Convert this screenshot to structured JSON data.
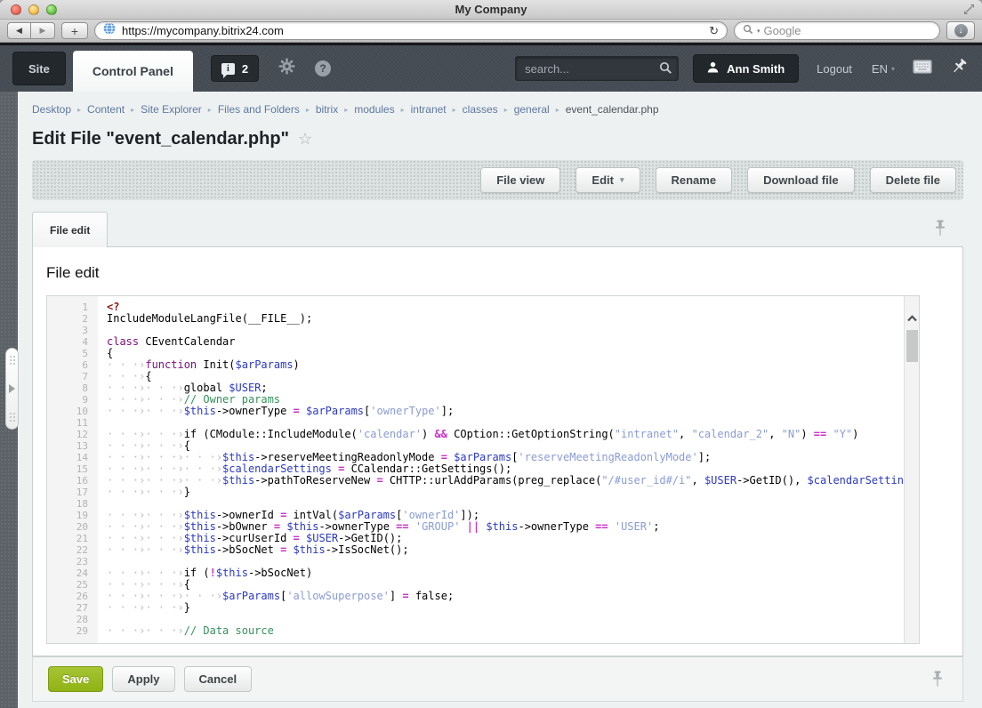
{
  "window": {
    "title": "My Company"
  },
  "browser": {
    "url": "https://mycompany.bitrix24.com",
    "web_search_placeholder": "Google"
  },
  "icons": {
    "back": "◀",
    "forward": "▶",
    "new_tab": "+",
    "reload": "↻",
    "download_arrow": "↓",
    "caret_down": "▾",
    "breadcrumb_separator": "▸",
    "info": "i",
    "help": "?",
    "star": "☆"
  },
  "header": {
    "site_tab_label": "Site",
    "control_panel_tab_label": "Control Panel",
    "notification_count": "2",
    "search_placeholder": "search...",
    "user_name": "Ann Smith",
    "logout_label": "Logout",
    "language_label": "EN"
  },
  "breadcrumb": {
    "items": [
      "Desktop",
      "Content",
      "Site Explorer",
      "Files and Folders",
      "bitrix",
      "modules",
      "intranet",
      "classes",
      "general",
      "event_calendar.php"
    ]
  },
  "page": {
    "title": "Edit File \"event_calendar.php\""
  },
  "toolbar": {
    "buttons": [
      {
        "label": "File view"
      },
      {
        "label": "Edit",
        "caret": true
      },
      {
        "label": "Rename"
      },
      {
        "label": "Download file"
      },
      {
        "label": "Delete file"
      }
    ]
  },
  "tab_bar": {
    "active_tab": "File edit"
  },
  "content": {
    "heading": "File edit"
  },
  "editor": {
    "lines": [
      [
        [
          "m",
          "<?"
        ]
      ],
      [
        [
          "d",
          "IncludeModuleLangFile(__FILE__);"
        ]
      ],
      [],
      [
        [
          "k",
          "class"
        ],
        [
          "d",
          " CEventCalendar"
        ]
      ],
      [
        [
          "d",
          "{"
        ]
      ],
      [
        [
          "w",
          "· · ·›"
        ],
        [
          "k",
          "function"
        ],
        [
          "d",
          " Init("
        ],
        [
          "v",
          "$arParams"
        ],
        [
          "d",
          ")"
        ]
      ],
      [
        [
          "w",
          "· · ·›"
        ],
        [
          "d",
          "{"
        ]
      ],
      [
        [
          "w",
          "· · ·›· · ·›"
        ],
        [
          "d",
          "global "
        ],
        [
          "v",
          "$USER"
        ],
        [
          "d",
          ";"
        ]
      ],
      [
        [
          "w",
          "· · ·›· · ·›"
        ],
        [
          "c",
          "// Owner params"
        ]
      ],
      [
        [
          "w",
          "· · ·›· · ·›"
        ],
        [
          "v",
          "$this"
        ],
        [
          "d",
          "->ownerType "
        ],
        [
          "o",
          "="
        ],
        [
          "d",
          " "
        ],
        [
          "v",
          "$arParams"
        ],
        [
          "d",
          "["
        ],
        [
          "s",
          "'ownerType'"
        ],
        [
          "d",
          "];"
        ]
      ],
      [],
      [
        [
          "w",
          "· · ·›· · ·›"
        ],
        [
          "d",
          "if (CModule::IncludeModule("
        ],
        [
          "s",
          "'calendar'"
        ],
        [
          "d",
          ") "
        ],
        [
          "o",
          "&&"
        ],
        [
          "d",
          " COption::GetOptionString("
        ],
        [
          "s",
          "\"intranet\""
        ],
        [
          "d",
          ", "
        ],
        [
          "s",
          "\"calendar_2\""
        ],
        [
          "d",
          ", "
        ],
        [
          "s",
          "\"N\""
        ],
        [
          "d",
          ") "
        ],
        [
          "o",
          "=="
        ],
        [
          "d",
          " "
        ],
        [
          "s",
          "\"Y\""
        ],
        [
          "d",
          ")"
        ]
      ],
      [
        [
          "w",
          "· · ·›· · ·›"
        ],
        [
          "d",
          "{"
        ]
      ],
      [
        [
          "w",
          "· · ·›· · ·›· · ·›"
        ],
        [
          "v",
          "$this"
        ],
        [
          "d",
          "->reserveMeetingReadonlyMode "
        ],
        [
          "o",
          "="
        ],
        [
          "d",
          " "
        ],
        [
          "v",
          "$arParams"
        ],
        [
          "d",
          "["
        ],
        [
          "s",
          "'reserveMeetingReadonlyMode'"
        ],
        [
          "d",
          "];"
        ]
      ],
      [
        [
          "w",
          "· · ·›· · ·›· · ·›"
        ],
        [
          "v",
          "$calendarSettings"
        ],
        [
          "d",
          " "
        ],
        [
          "o",
          "="
        ],
        [
          "d",
          " CCalendar::GetSettings();"
        ]
      ],
      [
        [
          "w",
          "· · ·›· · ·›· · ·›"
        ],
        [
          "v",
          "$this"
        ],
        [
          "d",
          "->pathToReserveNew "
        ],
        [
          "o",
          "="
        ],
        [
          "d",
          " CHTTP::urlAddParams(preg_replace("
        ],
        [
          "s",
          "\"/#user_id#/i\""
        ],
        [
          "d",
          ", "
        ],
        [
          "v",
          "$USER"
        ],
        [
          "d",
          "->GetID(), "
        ],
        [
          "v",
          "$calendarSettings"
        ],
        [
          "d",
          "["
        ]
      ],
      [
        [
          "w",
          "· · ·›· · ·›"
        ],
        [
          "d",
          "}"
        ]
      ],
      [],
      [
        [
          "w",
          "· · ·›· · ·›"
        ],
        [
          "v",
          "$this"
        ],
        [
          "d",
          "->ownerId "
        ],
        [
          "o",
          "="
        ],
        [
          "d",
          " intVal("
        ],
        [
          "v",
          "$arParams"
        ],
        [
          "d",
          "["
        ],
        [
          "s",
          "'ownerId'"
        ],
        [
          "d",
          "]);"
        ]
      ],
      [
        [
          "w",
          "· · ·›· · ·›"
        ],
        [
          "v",
          "$this"
        ],
        [
          "d",
          "->bOwner "
        ],
        [
          "o",
          "="
        ],
        [
          "d",
          " "
        ],
        [
          "v",
          "$this"
        ],
        [
          "d",
          "->ownerType "
        ],
        [
          "o",
          "=="
        ],
        [
          "d",
          " "
        ],
        [
          "s",
          "'GROUP'"
        ],
        [
          "d",
          " "
        ],
        [
          "o",
          "||"
        ],
        [
          "d",
          " "
        ],
        [
          "v",
          "$this"
        ],
        [
          "d",
          "->ownerType "
        ],
        [
          "o",
          "=="
        ],
        [
          "d",
          " "
        ],
        [
          "s",
          "'USER'"
        ],
        [
          "d",
          ";"
        ]
      ],
      [
        [
          "w",
          "· · ·›· · ·›"
        ],
        [
          "v",
          "$this"
        ],
        [
          "d",
          "->curUserId "
        ],
        [
          "o",
          "="
        ],
        [
          "d",
          " "
        ],
        [
          "v",
          "$USER"
        ],
        [
          "d",
          "->GetID();"
        ]
      ],
      [
        [
          "w",
          "· · ·›· · ·›"
        ],
        [
          "v",
          "$this"
        ],
        [
          "d",
          "->bSocNet "
        ],
        [
          "o",
          "="
        ],
        [
          "d",
          " "
        ],
        [
          "v",
          "$this"
        ],
        [
          "d",
          "->IsSocNet();"
        ]
      ],
      [],
      [
        [
          "w",
          "· · ·›· · ·›"
        ],
        [
          "d",
          "if ("
        ],
        [
          "o",
          "!"
        ],
        [
          "v",
          "$this"
        ],
        [
          "d",
          "->bSocNet)"
        ]
      ],
      [
        [
          "w",
          "· · ·›· · ·›"
        ],
        [
          "d",
          "{"
        ]
      ],
      [
        [
          "w",
          "· · ·›· · ·›· · ·›"
        ],
        [
          "v",
          "$arParams"
        ],
        [
          "d",
          "["
        ],
        [
          "s",
          "'allowSuperpose'"
        ],
        [
          "d",
          "] "
        ],
        [
          "o",
          "="
        ],
        [
          "d",
          " false;"
        ]
      ],
      [
        [
          "w",
          "· · ·›· · ·›"
        ],
        [
          "d",
          "}"
        ]
      ],
      [],
      [
        [
          "w",
          "· · ·›· · ·›"
        ],
        [
          "c",
          "// Data source"
        ]
      ]
    ]
  },
  "footer": {
    "save_label": "Save",
    "apply_label": "Apply",
    "cancel_label": "Cancel"
  },
  "colors": {
    "accent_green": "#8fb315",
    "header_bg": "#454c54",
    "breadcrumb_link": "#5e78a1",
    "syntax_keyword": "#7c0d7c",
    "syntax_variable": "#2a39c4",
    "syntax_string": "#8a9cd4",
    "syntax_operator": "#cb33cb",
    "syntax_comment": "#35915c",
    "syntax_maroon": "#8e1414",
    "syntax_ws": "#bcbcbc"
  }
}
